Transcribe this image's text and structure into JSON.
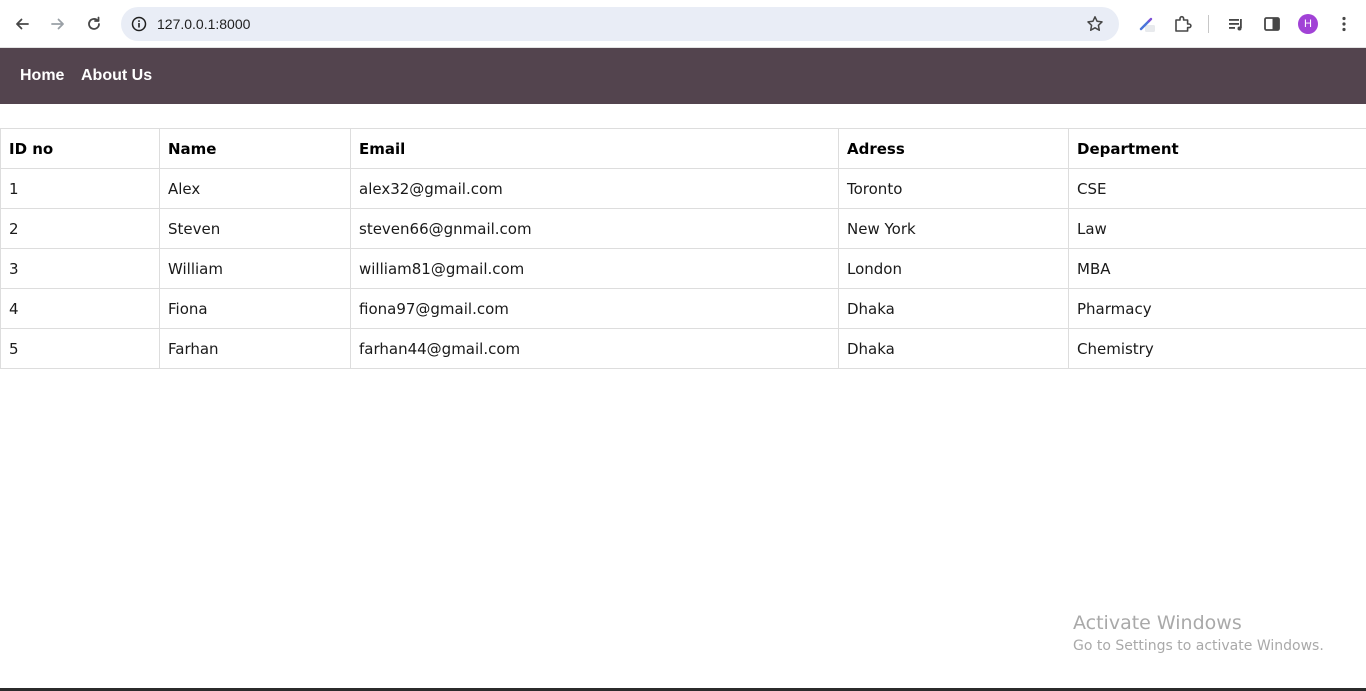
{
  "browser": {
    "url": "127.0.0.1:8000",
    "profile_initial": "H",
    "icons": {
      "back": "arrow-left-icon",
      "forward": "arrow-right-icon",
      "reload": "reload-icon",
      "site_info": "info-icon",
      "bookmark": "star-icon",
      "extension_pen": "pen-icon",
      "extensions": "puzzle-icon",
      "media": "media-queue-icon",
      "side_panel": "side-panel-icon",
      "menu": "kebab-menu-icon"
    }
  },
  "nav": {
    "links": [
      "Home",
      "About Us"
    ],
    "background": "#53444e"
  },
  "table": {
    "headers": [
      "ID no",
      "Name",
      "Email",
      "Adress",
      "Department"
    ],
    "rows": [
      [
        "1",
        "Alex",
        "alex32@gmail.com",
        "Toronto",
        "CSE"
      ],
      [
        "2",
        "Steven",
        "steven66@gnmail.com",
        "New York",
        "Law"
      ],
      [
        "3",
        "William",
        "william81@gmail.com",
        "London",
        "MBA"
      ],
      [
        "4",
        "Fiona",
        "fiona97@gmail.com",
        "Dhaka",
        "Pharmacy"
      ],
      [
        "5",
        "Farhan",
        "farhan44@gmail.com",
        "Dhaka",
        "Chemistry"
      ]
    ]
  },
  "watermark": {
    "title": "Activate Windows",
    "subtitle": "Go to Settings to activate Windows."
  }
}
